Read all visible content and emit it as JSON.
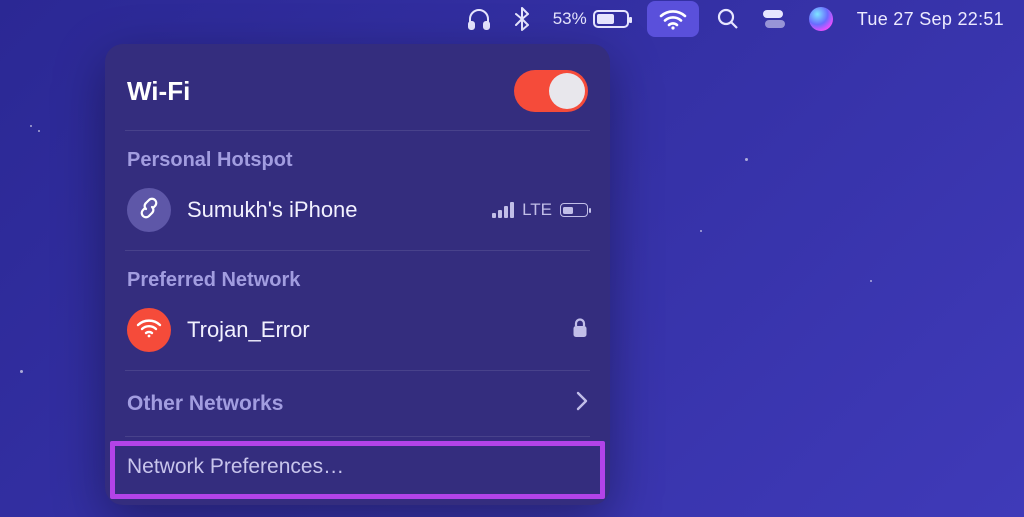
{
  "menubar": {
    "battery_percent": "53%",
    "datetime": "Tue 27 Sep  22:51"
  },
  "dropdown": {
    "title": "Wi-Fi",
    "hotspot": {
      "heading": "Personal Hotspot",
      "device": "Sumukh's iPhone",
      "network_type": "LTE"
    },
    "preferred": {
      "heading": "Preferred Network",
      "ssid": "Trojan_Error"
    },
    "other_label": "Other Networks",
    "prefs_label": "Network Preferences…"
  }
}
